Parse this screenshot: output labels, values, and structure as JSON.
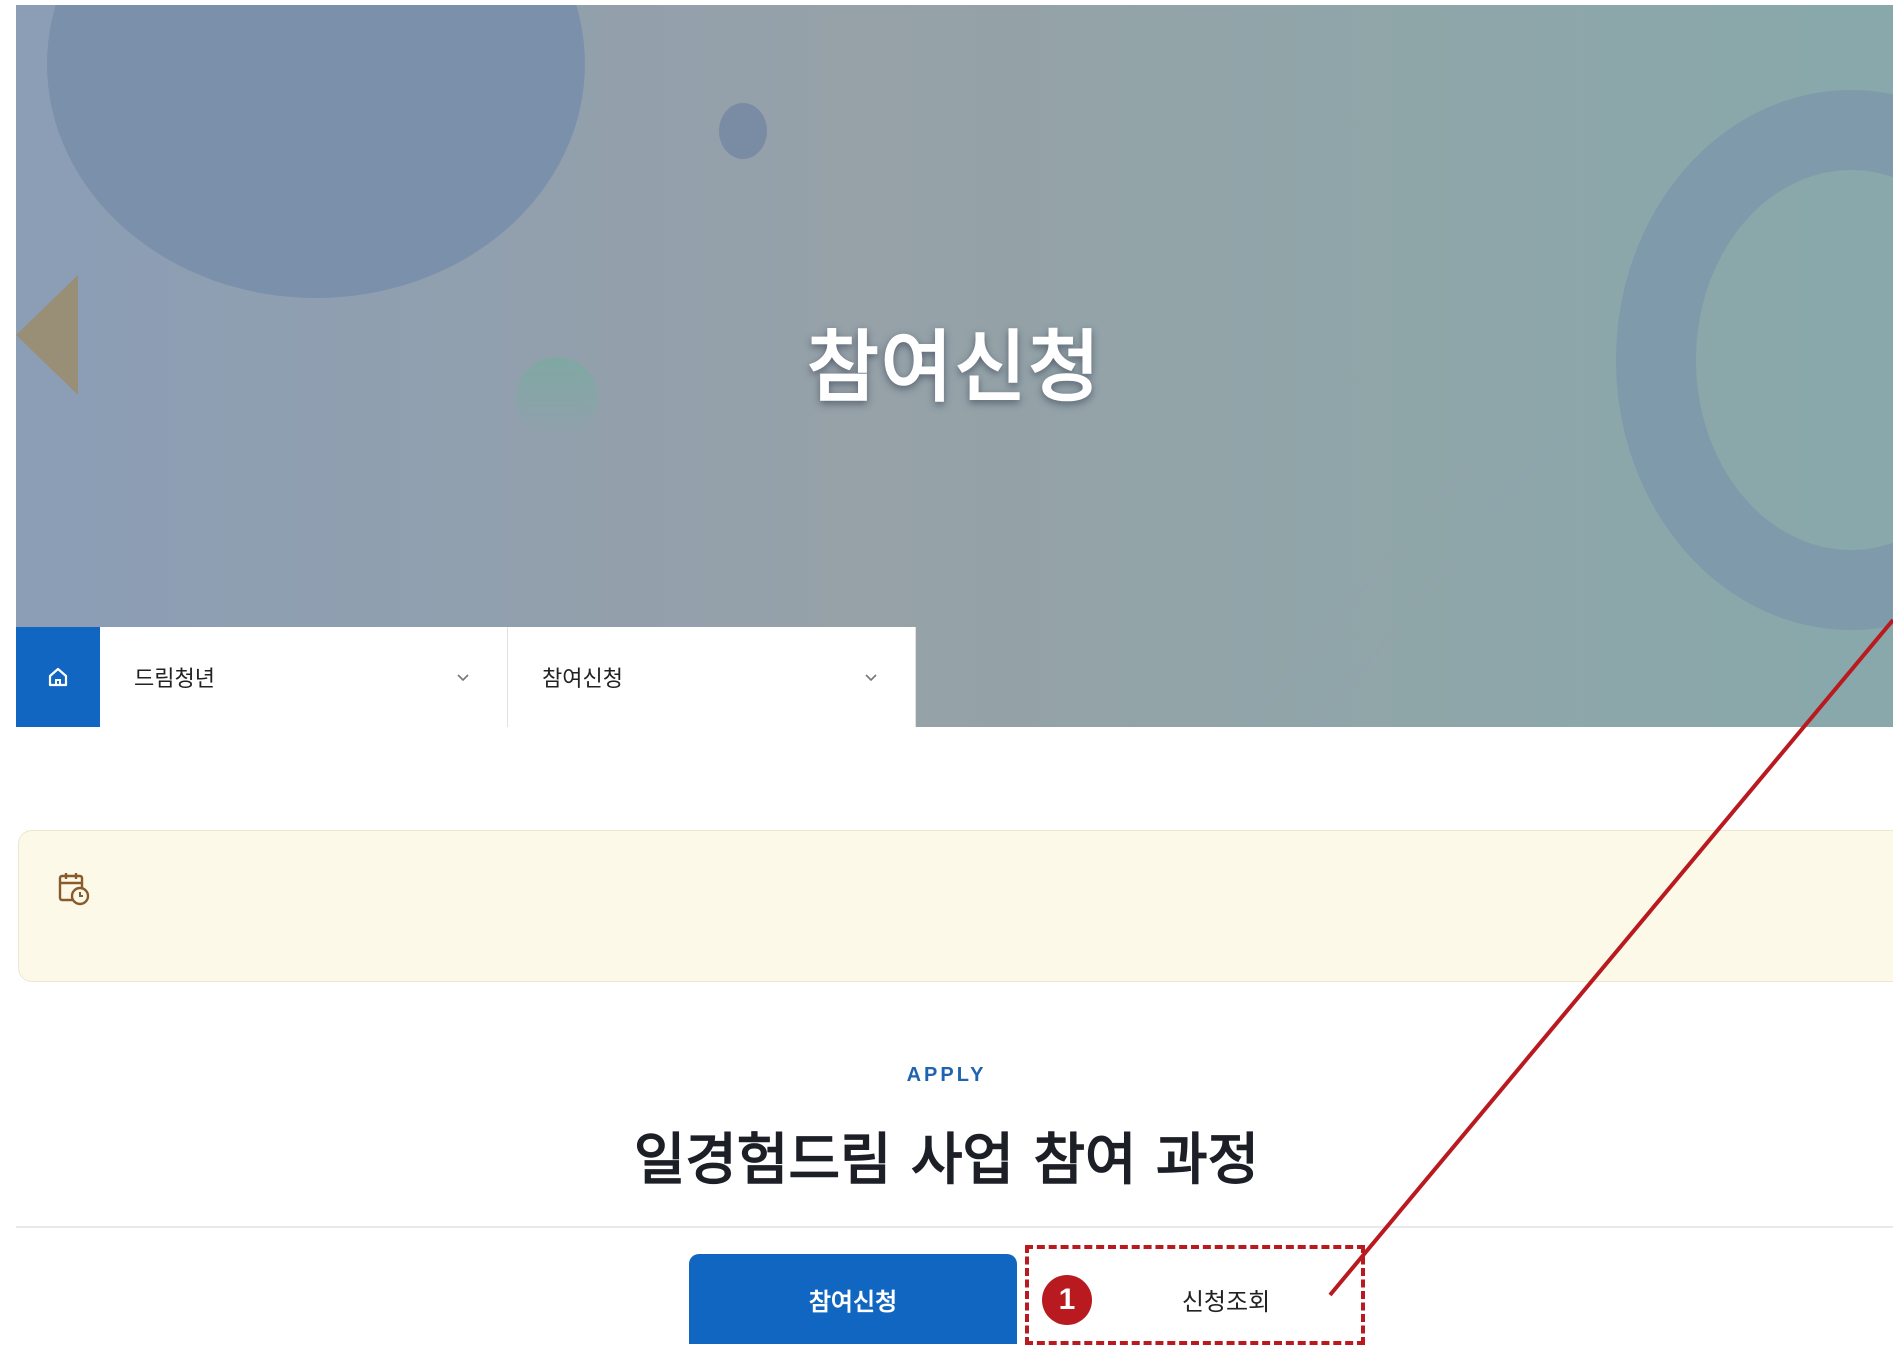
{
  "hero": {
    "title": "참여신청"
  },
  "breadcrumb": {
    "home_icon": "home-icon",
    "items": [
      {
        "label": "드림청년",
        "icon": "chevron-down-icon"
      },
      {
        "label": "참여신청",
        "icon": "chevron-down-icon"
      }
    ]
  },
  "notice": {
    "icon": "calendar-clock-icon"
  },
  "section": {
    "eyebrow": "APPLY",
    "title": "일경험드림 사업 참여 과정"
  },
  "tabs": [
    {
      "label": "참여신청",
      "active": true
    },
    {
      "label": "신청조회",
      "active": false
    }
  ],
  "annotation": {
    "step_number": "1",
    "color": "#b81a1f"
  },
  "colors": {
    "primary": "#1166c2",
    "eyebrow": "#1f64ad",
    "notice_background": "#fdf9e8",
    "annotation": "#b81a1f"
  }
}
